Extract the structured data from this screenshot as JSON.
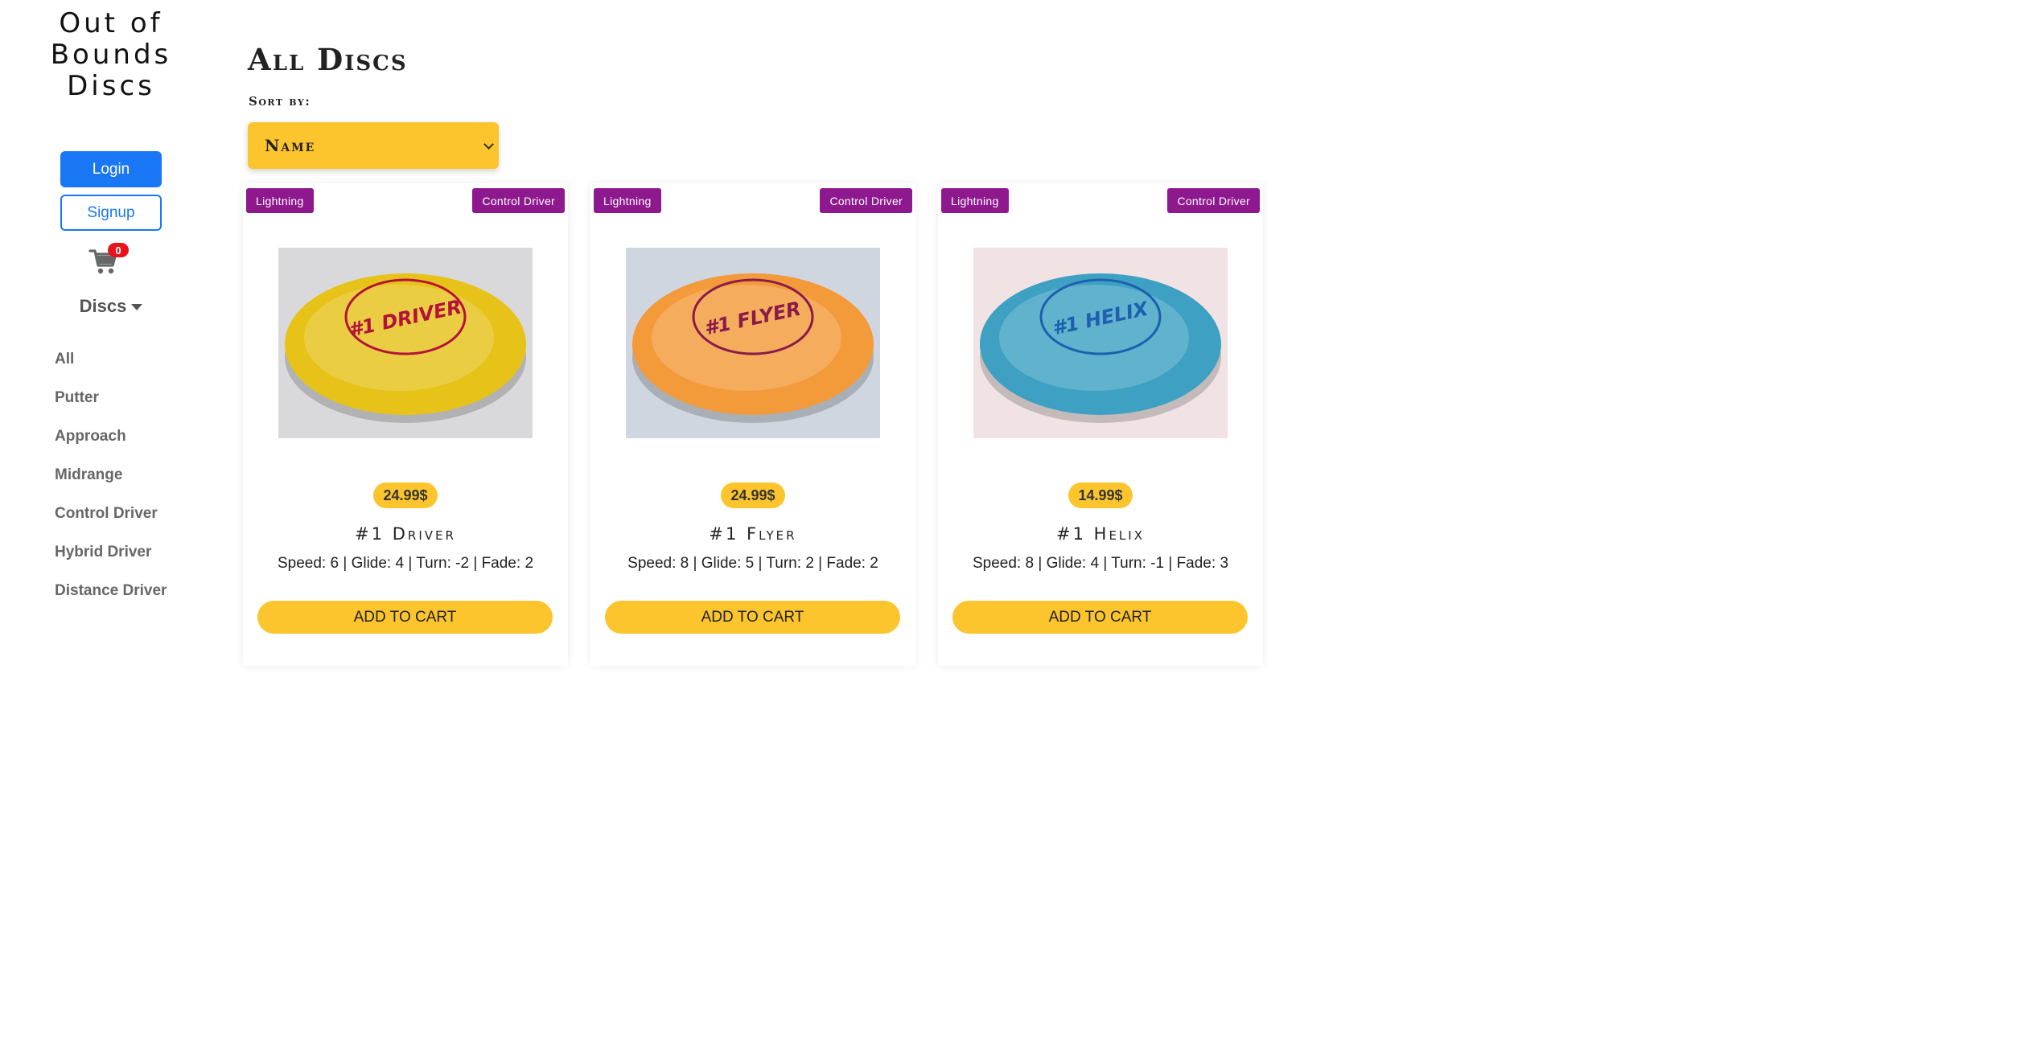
{
  "sidebar": {
    "brand": "Out of Bounds Discs",
    "login_label": "Login",
    "signup_label": "Signup",
    "cart_count": "0",
    "discs_toggle": "Discs",
    "categories": [
      "All",
      "Putter",
      "Approach",
      "Midrange",
      "Control Driver",
      "Hybrid Driver",
      "Distance Driver"
    ]
  },
  "main": {
    "title": "All Discs",
    "sort_label": "Sort by:",
    "sort_value": "Name"
  },
  "products": [
    {
      "brand_tag": "Lightning",
      "type_tag": "Control Driver",
      "price": "24.99$",
      "name": "#1 Driver",
      "speed_label": "Speed:",
      "speed": "6",
      "glide_label": "Glide:",
      "glide": "4",
      "turn_label": "Turn:",
      "turn": "-2",
      "fade_label": "Fade:",
      "fade": "2",
      "button": "ADD TO CART",
      "stamp_text": "#1 DRIVER",
      "disc_color": "#e7c31a",
      "stamp_color": "#b4123a"
    },
    {
      "brand_tag": "Lightning",
      "type_tag": "Control Driver",
      "price": "24.99$",
      "name": "#1 Flyer",
      "speed_label": "Speed:",
      "speed": "8",
      "glide_label": "Glide:",
      "glide": "5",
      "turn_label": "Turn:",
      "turn": "2",
      "fade_label": "Fade:",
      "fade": "2",
      "button": "ADD TO CART",
      "stamp_text": "#1 FLYER",
      "disc_color": "#f39a3a",
      "stamp_color": "#8a1a4a"
    },
    {
      "brand_tag": "Lightning",
      "type_tag": "Control Driver",
      "price": "14.99$",
      "name": "#1 Helix",
      "speed_label": "Speed:",
      "speed": "8",
      "glide_label": "Glide:",
      "glide": "4",
      "turn_label": "Turn:",
      "turn": "-1",
      "fade_label": "Fade:",
      "fade": "3",
      "button": "ADD TO CART",
      "stamp_text": "#1 HELIX",
      "disc_color": "#3ea1c3",
      "stamp_color": "#1d5fb0"
    }
  ],
  "colors": {
    "primary": "#1976f5",
    "accent": "#fcc52d",
    "tag": "#8e198e",
    "badge": "#e8141b"
  }
}
